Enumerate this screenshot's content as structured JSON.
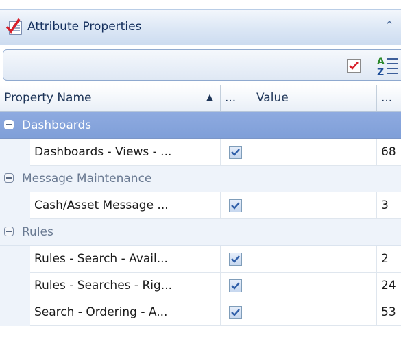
{
  "window": {
    "title": "Attribute Properties"
  },
  "toolbar": {
    "buttons": [
      {
        "name": "filter-checked",
        "icon": "checkbox-red-check-icon"
      },
      {
        "name": "sort-alphabetical",
        "icon": "az-sort-icon"
      }
    ]
  },
  "columns": [
    {
      "label": "Property Name",
      "sort": "ascending"
    },
    {
      "label": "..."
    },
    {
      "label": "Value"
    },
    {
      "label": "..."
    }
  ],
  "categories": [
    {
      "label": "Dashboards",
      "selected": true,
      "rows": [
        {
          "name": "Dashboards - Views - ...",
          "checked": true,
          "value": "",
          "num": "68"
        }
      ]
    },
    {
      "label": "Message Maintenance",
      "selected": false,
      "rows": [
        {
          "name": "Cash/Asset Message ...",
          "checked": true,
          "value": "",
          "num": "3"
        }
      ]
    },
    {
      "label": "Rules",
      "selected": false,
      "rows": [
        {
          "name": "Rules - Search - Avail...",
          "checked": true,
          "value": "",
          "num": "2"
        },
        {
          "name": "Rules - Searches - Rig...",
          "checked": true,
          "value": "",
          "num": "24"
        },
        {
          "name": "Search - Ordering - A...",
          "checked": true,
          "value": "",
          "num": "53"
        }
      ]
    }
  ],
  "colors": {
    "accent_title": "#15305e",
    "selected_row": "#8eaae0",
    "checkbox_red": "#d8202b",
    "checkbox_tick": "#2f5ea8"
  }
}
